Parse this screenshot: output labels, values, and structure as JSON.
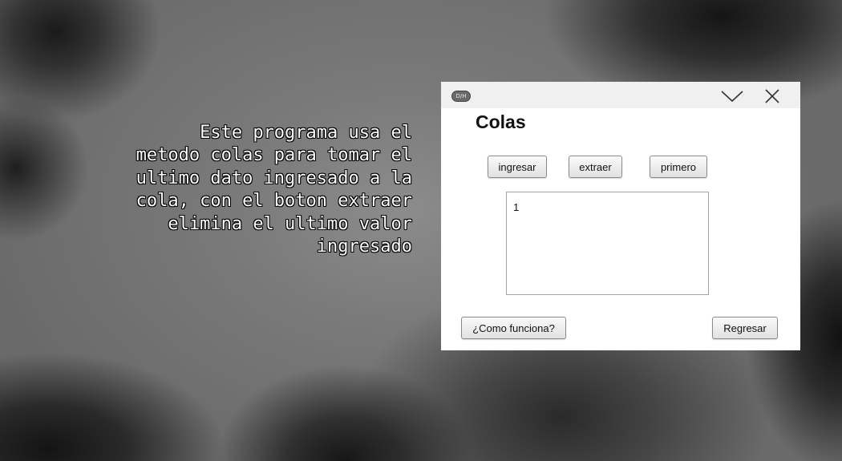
{
  "caption": {
    "text": "Este programa usa el metodo colas para tomar el ultimo dato ingresado a la cola, con el boton extraer elimina el ultimo valor ingresado"
  },
  "window": {
    "icon_label": "D/H",
    "app_icon": "app-icon",
    "minimize_icon": "chevron-down-icon",
    "close_icon": "close-icon",
    "title": "Colas",
    "buttons": {
      "ingresar": "ingresar",
      "extraer": "extraer",
      "primero": "primero",
      "help": "¿Como funciona?",
      "back": "Regresar"
    },
    "output": {
      "value": "1"
    }
  }
}
